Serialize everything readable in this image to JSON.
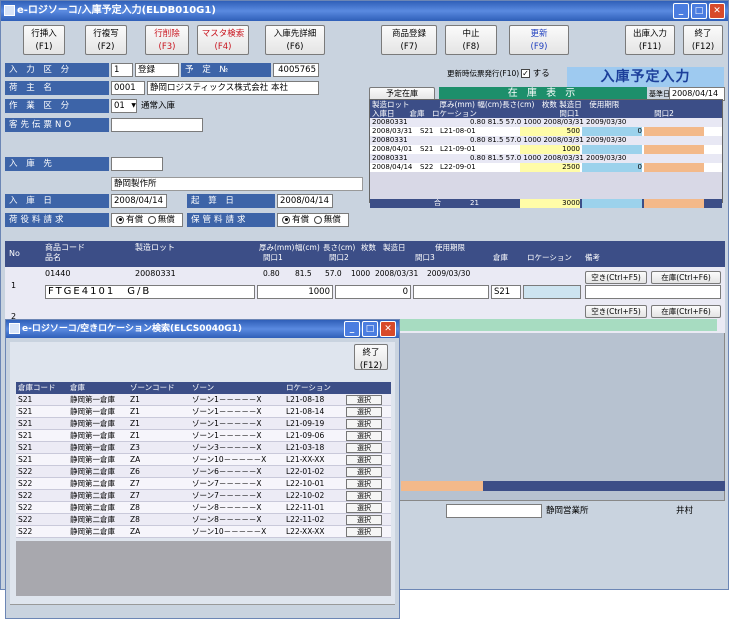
{
  "main_window": {
    "title": "e-ロジソーコ/入庫予定入力(ELDB010G1)",
    "fkeys": [
      {
        "name": "F1",
        "label": "行挿入",
        "key": "(F1)"
      },
      {
        "name": "F2",
        "label": "行複写",
        "key": "(F2)"
      },
      {
        "name": "F3",
        "label": "行削除",
        "key": "(F3)"
      },
      {
        "name": "F4",
        "label": "マスタ検索",
        "key": "(F4)"
      },
      {
        "name": "F6",
        "label": "入庫先詳細",
        "key": "(F6)"
      },
      {
        "name": "F7",
        "label": "商品登録",
        "key": "(F7)"
      },
      {
        "name": "F8",
        "label": "中止",
        "key": "(F8)"
      },
      {
        "name": "F9",
        "label": "更新",
        "key": "(F9)"
      },
      {
        "name": "F11",
        "label": "出庫入力",
        "key": "(F11)"
      },
      {
        "name": "F12",
        "label": "終了",
        "key": "(F12)"
      }
    ],
    "form": {
      "input_division_label": "入 力 区 分",
      "input_division_code": "1",
      "input_division_name": "登録",
      "schedule_no_label": "予 定 №",
      "schedule_no": "4005765",
      "shipper_label": "荷 主 名",
      "shipper_code": "0001",
      "shipper_name": "静岡ロジスティックス株式会社 本社",
      "work_division_label": "作 業 区 分",
      "work_division_code": "01",
      "work_division_name": "通常入庫",
      "customer_no_label": "客先伝票NO",
      "customer_no": "",
      "receiving_label": "入 庫 先",
      "receiving_code": "",
      "receiving_name": "静岡製作所",
      "receiving_date_label": "入 庫 日",
      "receiving_date": "2008/04/14",
      "booking_date_label": "起 算 日",
      "booking_date": "2008/04/14",
      "cargo_fee_label": "荷役料請求",
      "cargo_fee_on": "有償",
      "cargo_fee_off": "無償",
      "storage_fee_label": "保管料請求",
      "storage_fee_on": "有償",
      "storage_fee_off": "無償",
      "stock_print_label": "更新時伝票発行(F10)",
      "stock_print_check": "する",
      "scheduled_stock_button": "予定在庫(Ctrl+F7)",
      "stock_display": "在 庫 表 示",
      "base_date_label": "基準日",
      "base_date": "2008/04/14"
    },
    "banner": "入庫予定入力",
    "stock_grid": {
      "header1": "製造ロット　　　　厚み(mm) 幅(cm)長さ(cm)　枚数 製造日　使用期限",
      "header2": "入庫日　　倉庫　ロケーション　　　　　　　　　　　間口1　　　　　　　　　　間口2　　　　　　　　　　間口3",
      "rows": [
        {
          "lot": "20080331",
          "spec": "0.80  81.5  57.0  1000 2008/03/31 2009/03/30",
          "date": "2008/03/31",
          "wh": "S21",
          "loc": "L21-08-01",
          "qty": "500",
          "qty2": "0"
        },
        {
          "lot": "20080331",
          "spec": "0.80  81.5  57.0  1000 2008/03/31 2009/03/30",
          "date": "2008/04/01",
          "wh": "S21",
          "loc": "L21-09-01",
          "qty": "1000",
          "qty2": ""
        },
        {
          "lot": "20080331",
          "spec": "0.80  81.5  57.0  1000 2008/03/31 2009/03/30",
          "date": "2008/04/14",
          "wh": "S22",
          "loc": "L22-09-01",
          "qty": "2500",
          "qty2": "0"
        }
      ],
      "total_label": "合",
      "total_count": "21",
      "total_qty": "3000"
    },
    "detail": {
      "col_no": "No",
      "col_product_code": "商品コード",
      "col_product_name": "品名",
      "col_lot": "製造ロット",
      "col_thickness": "厚み(mm)",
      "col_width": "幅(cm)",
      "col_length": "長さ(cm)",
      "col_sheets": "枚数",
      "col_mfg_date": "製造日",
      "col_expiry": "使用期限",
      "col_frontage1": "間口1",
      "col_frontage2": "間口2",
      "col_frontage3": "間口3",
      "col_warehouse": "倉庫",
      "col_location": "ロケーション",
      "col_remarks": "備考",
      "row1_no": "1",
      "row1_code": "01440",
      "row1_lot": "20080331",
      "row1_thickness": "0.80",
      "row1_width": "81.5",
      "row1_length": "57.0",
      "row1_sheets": "1000",
      "row1_mfg": "2008/03/31",
      "row1_expiry": "2009/03/30",
      "row1_name": "FTGE4101　G/B",
      "row1_q1": "1000",
      "row1_q2": "0",
      "row1_wh": "S21",
      "row2_no": "2",
      "empty_btn": "空き(Ctrl+F5)",
      "stock_btn": "在庫(Ctrl+F6)"
    },
    "status_office": "静岡営業所",
    "status_user": "井村"
  },
  "popup": {
    "title": "e-ロジソーコ/空きロケーション検索(ELCS0040G1)",
    "close_label": "終了",
    "close_key": "(F12)",
    "headers": [
      "倉庫コード",
      "倉庫",
      "ゾーンコード",
      "ゾーン",
      "ロケーション",
      ""
    ],
    "select_label": "選択",
    "rows": [
      [
        "S21",
        "静岡第一倉庫",
        "Z1",
        "ゾーン1－－－－－X",
        "L21-08-18"
      ],
      [
        "S21",
        "静岡第一倉庫",
        "Z1",
        "ゾーン1－－－－－X",
        "L21-08-14"
      ],
      [
        "S21",
        "静岡第一倉庫",
        "Z1",
        "ゾーン1－－－－－X",
        "L21-09-19"
      ],
      [
        "S21",
        "静岡第一倉庫",
        "Z1",
        "ゾーン1－－－－－X",
        "L21-09-06"
      ],
      [
        "S21",
        "静岡第一倉庫",
        "Z3",
        "ゾーン3－－－－－X",
        "L21-03-18"
      ],
      [
        "S21",
        "静岡第一倉庫",
        "ZA",
        "ゾーン10－－－－－X",
        "L21-XX-XX"
      ],
      [
        "S22",
        "静岡第二倉庫",
        "Z6",
        "ゾーン6－－－－－X",
        "L22-01-02"
      ],
      [
        "S22",
        "静岡第二倉庫",
        "Z7",
        "ゾーン7－－－－－X",
        "L22-10-01"
      ],
      [
        "S22",
        "静岡第二倉庫",
        "Z7",
        "ゾーン7－－－－－X",
        "L22-10-02"
      ],
      [
        "S22",
        "静岡第二倉庫",
        "Z8",
        "ゾーン8－－－－－X",
        "L22-11-01"
      ],
      [
        "S22",
        "静岡第二倉庫",
        "Z8",
        "ゾーン8－－－－－X",
        "L22-11-02"
      ],
      [
        "S22",
        "静岡第二倉庫",
        "ZA",
        "ゾーン10－－－－－X",
        "L22-XX-XX"
      ]
    ]
  }
}
